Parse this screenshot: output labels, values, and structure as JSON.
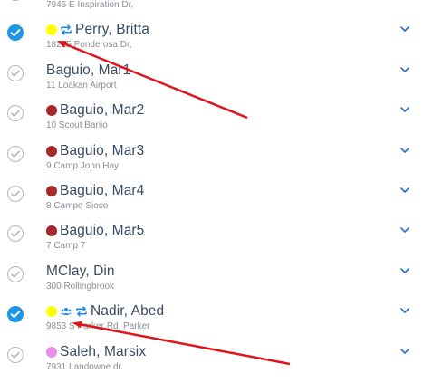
{
  "colors": {
    "checked": "#1e96e8",
    "unchecked": "#b8b8b8",
    "name_text": "#3a4a62",
    "address_text": "#8c8f96",
    "chevron": "#2a6fd6",
    "icon_blue": "#1e8ae6",
    "arrow_red": "#e0141b",
    "dot_yellow": "#ffff00",
    "dot_maroon": "#a5282a",
    "dot_pink": "#ea8ee6"
  },
  "stops": [
    {
      "name": "",
      "address": "7945 E Inspiration Dr,",
      "checked": false,
      "dot": null,
      "icons": []
    },
    {
      "name": "Perry, Britta",
      "address": "18225 Ponderosa Dr,",
      "checked": true,
      "dot": "dot_yellow",
      "icons": [
        "repeat-icon"
      ]
    },
    {
      "name": "Baguio, Mar1",
      "address": "11 Loakan Airport",
      "checked": false,
      "dot": null,
      "icons": []
    },
    {
      "name": "Baguio, Mar2",
      "address": "10 Scout Bariio",
      "checked": false,
      "dot": "dot_maroon",
      "icons": []
    },
    {
      "name": "Baguio, Mar3",
      "address": "9 Camp John Hay",
      "checked": false,
      "dot": "dot_maroon",
      "icons": []
    },
    {
      "name": "Baguio, Mar4",
      "address": "8 Campo Sioco",
      "checked": false,
      "dot": "dot_maroon",
      "icons": []
    },
    {
      "name": "Baguio, Mar5",
      "address": "7 Camp 7",
      "checked": false,
      "dot": "dot_maroon",
      "icons": []
    },
    {
      "name": "MClay, Din",
      "address": "300 Rollingbrook",
      "checked": false,
      "dot": null,
      "icons": []
    },
    {
      "name": "Nadir, Abed",
      "address": "9853 S Parker Rd, Parker",
      "checked": true,
      "dot": "dot_yellow",
      "icons": [
        "group-icon",
        "repeat-icon"
      ]
    },
    {
      "name": "Saleh, Marsix",
      "address": "7931 Landowne dr.",
      "checked": false,
      "dot": "dot_pink",
      "icons": []
    }
  ]
}
